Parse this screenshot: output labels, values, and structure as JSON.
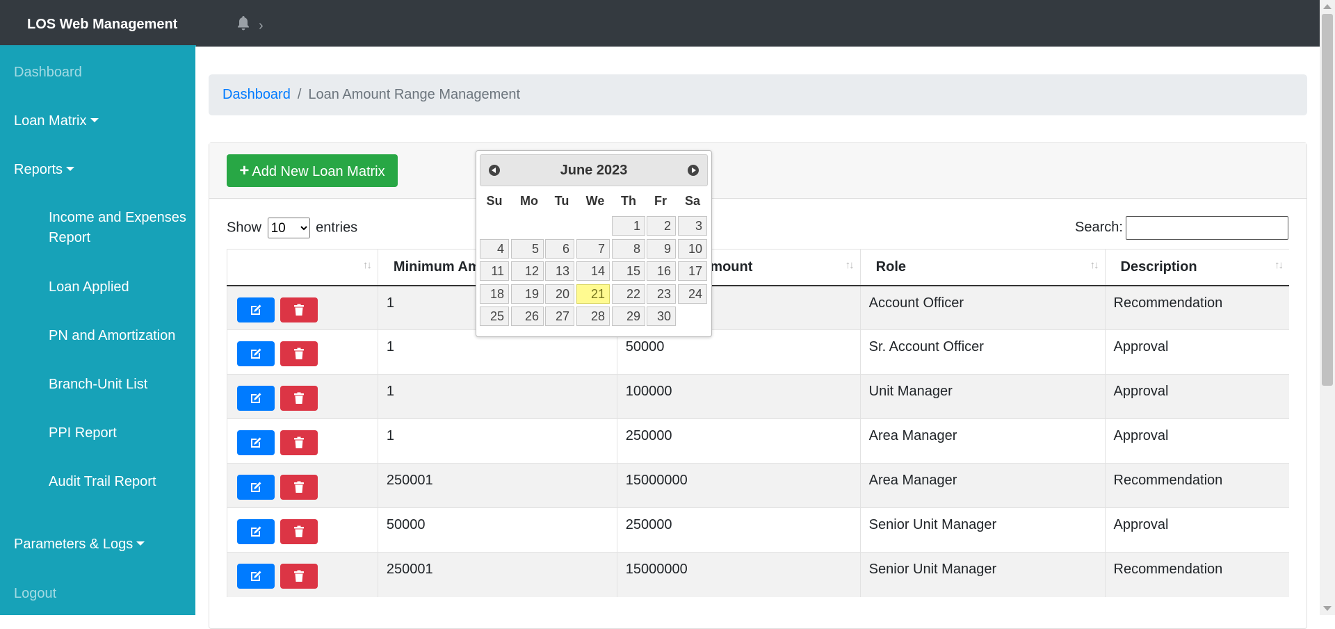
{
  "app": {
    "title": "LOS Web Management"
  },
  "sidebar": {
    "dashboard": "Dashboard",
    "loan_matrix": "Loan Matrix",
    "reports": "Reports",
    "report_items": [
      "Income and Expenses Report",
      "Loan Applied",
      "PN and Amortization",
      "Branch-Unit List",
      "PPI Report",
      "Audit Trail Report"
    ],
    "parameters": "Parameters & Logs",
    "logout": "Logout"
  },
  "breadcrumb": {
    "home": "Dashboard",
    "separator": "/",
    "current": "Loan Amount Range Management"
  },
  "toolbar": {
    "add_label": "Add New Loan Matrix"
  },
  "datatable": {
    "show_label": "Show",
    "page_size": "10",
    "entries_label": "entries",
    "search_label": "Search:",
    "search_value": ""
  },
  "table": {
    "columns": [
      "",
      "Minimum Amount",
      "Maximum Amount",
      "Role",
      "Description"
    ],
    "rows": [
      [
        "1",
        "",
        "Account Officer",
        "Recommendation"
      ],
      [
        "1",
        "50000",
        "Sr. Account Officer",
        "Approval"
      ],
      [
        "1",
        "100000",
        "Unit Manager",
        "Approval"
      ],
      [
        "1",
        "250000",
        "Area Manager",
        "Approval"
      ],
      [
        "250001",
        "15000000",
        "Area Manager",
        "Recommendation"
      ],
      [
        "50000",
        "250000",
        "Senior Unit Manager",
        "Approval"
      ],
      [
        "250001",
        "15000000",
        "Senior Unit Manager",
        "Recommendation"
      ]
    ]
  },
  "datepicker": {
    "title": "June 2023",
    "weekdays": [
      "Su",
      "Mo",
      "Tu",
      "We",
      "Th",
      "Fr",
      "Sa"
    ],
    "first_weekday_index": 4,
    "days_in_month": 30,
    "highlighted_day": 21
  },
  "colors": {
    "topbar": "#343a40",
    "sidebar": "#17a2b8",
    "add_button": "#28a745",
    "edit_button": "#007bff",
    "delete_button": "#dc3545",
    "today_highlight": "#fffa90"
  },
  "icons": {
    "notifications": "bell-icon",
    "expand": "chevron-right-icon",
    "edit": "edit-icon",
    "delete": "trash-icon",
    "add": "plus-icon"
  }
}
